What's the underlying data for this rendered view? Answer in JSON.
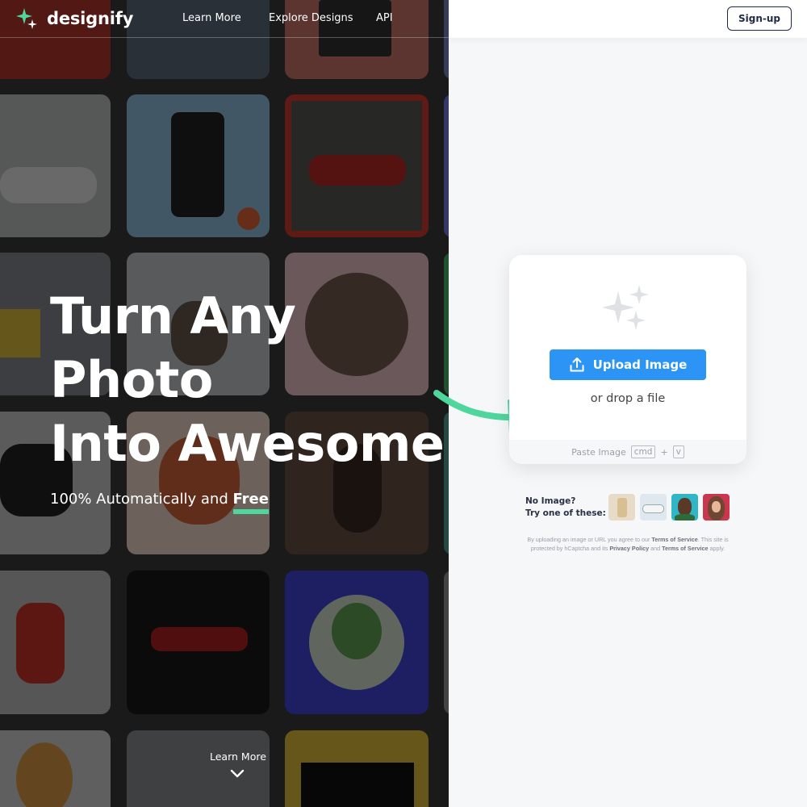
{
  "brand": {
    "name": "designify",
    "accent": "#4fd69c",
    "primary": "#2b94f5"
  },
  "nav": {
    "links": [
      "Learn More",
      "Explore Designs",
      "API"
    ],
    "signup": "Sign-up"
  },
  "hero": {
    "headline_line1": "Turn Any",
    "headline_line2": "Photo",
    "headline_line3": "Into Awesome",
    "subline_prefix": "100% Automatically and ",
    "subline_highlight": "Free",
    "learn_more": "Learn More"
  },
  "upload": {
    "button_label": "Upload Image",
    "drop_text": "or drop a file",
    "paste_label": "Paste Image",
    "paste_key1": "cmd",
    "paste_plus": "+",
    "paste_key2": "v"
  },
  "samples": {
    "line1": "No Image?",
    "line2": "Try one of these:",
    "items": [
      "sample-product",
      "sample-car",
      "sample-man",
      "sample-woman"
    ]
  },
  "legal": {
    "t1": "By uploading an image or URL you agree to our ",
    "l1": "Terms of Service",
    "t2": ". This site is protected by hCaptcha and its ",
    "l2": "Privacy Policy",
    "t3": " and ",
    "l3": "Terms of Service",
    "t4": " apply."
  }
}
